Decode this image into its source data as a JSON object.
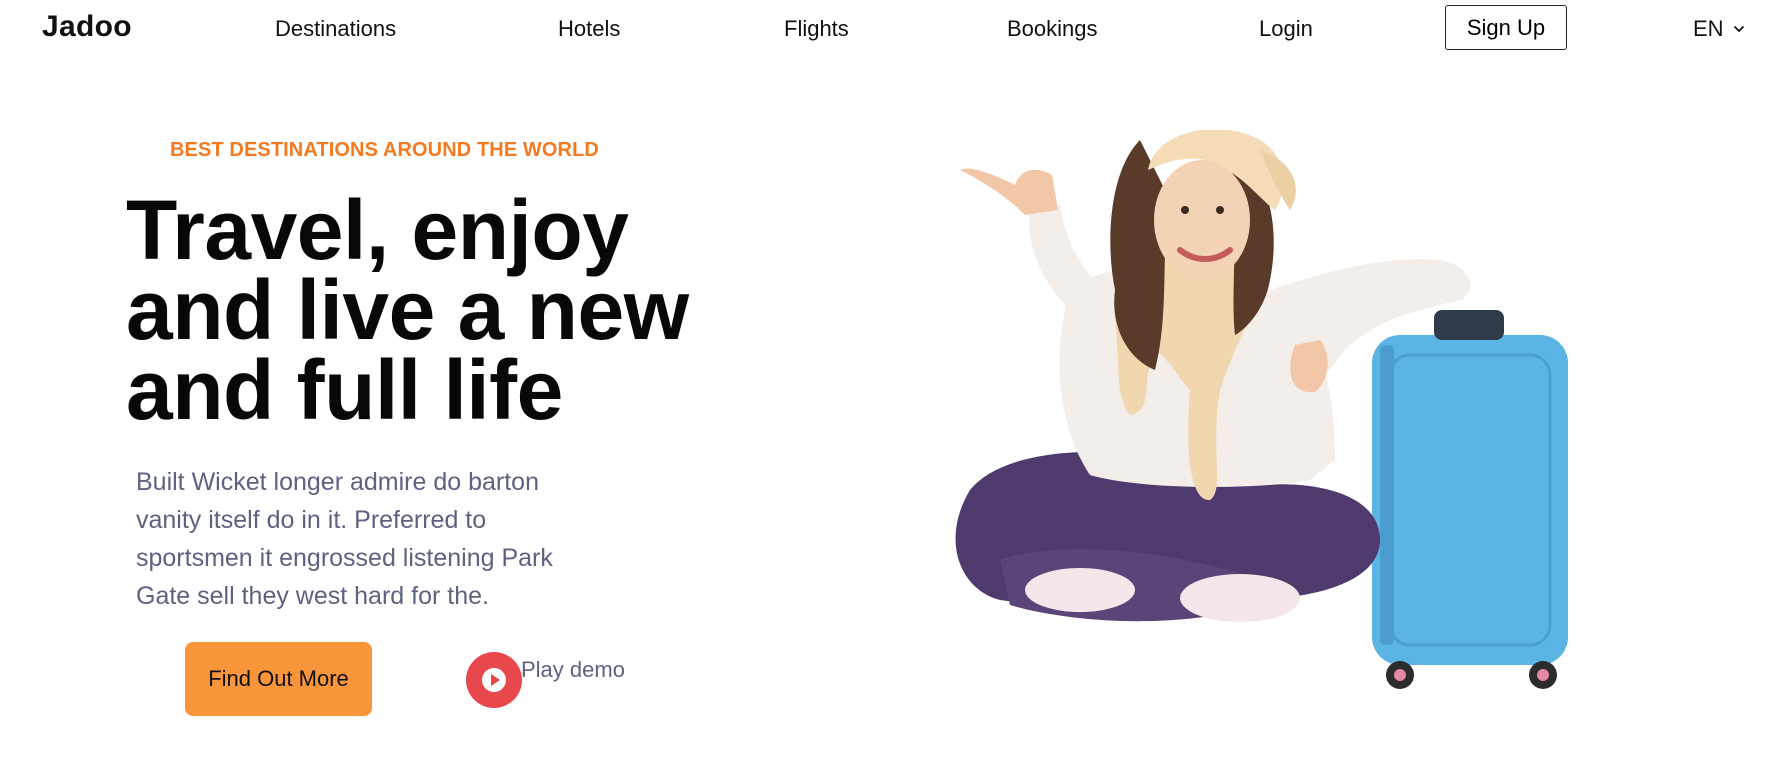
{
  "nav": {
    "logo": "Jadoo",
    "links": [
      "Destinations",
      "Hotels",
      "Flights",
      "Bookings",
      "Login"
    ],
    "signup": "Sign Up",
    "lang": "EN"
  },
  "hero": {
    "eyebrow": "BEST DESTINATIONS AROUND THE WORLD",
    "headline": [
      "Travel, enjoy",
      "and live a new",
      "and full life"
    ],
    "description": "Built Wicket longer admire do barton vanity itself do in it. Preferred to sportsmen it engrossed listening Park Gate sell they west hard for the.",
    "cta_label": "Find Out More",
    "play_label": "Play demo"
  },
  "colors": {
    "accent_orange": "#f47a1f",
    "button_orange": "#f9963b",
    "play_red": "#e8474c",
    "text_gray": "#5e6282",
    "suitcase_blue": "#5ab4e4"
  },
  "icons": {
    "language_dropdown": "chevron-down-icon",
    "play": "play-icon"
  }
}
